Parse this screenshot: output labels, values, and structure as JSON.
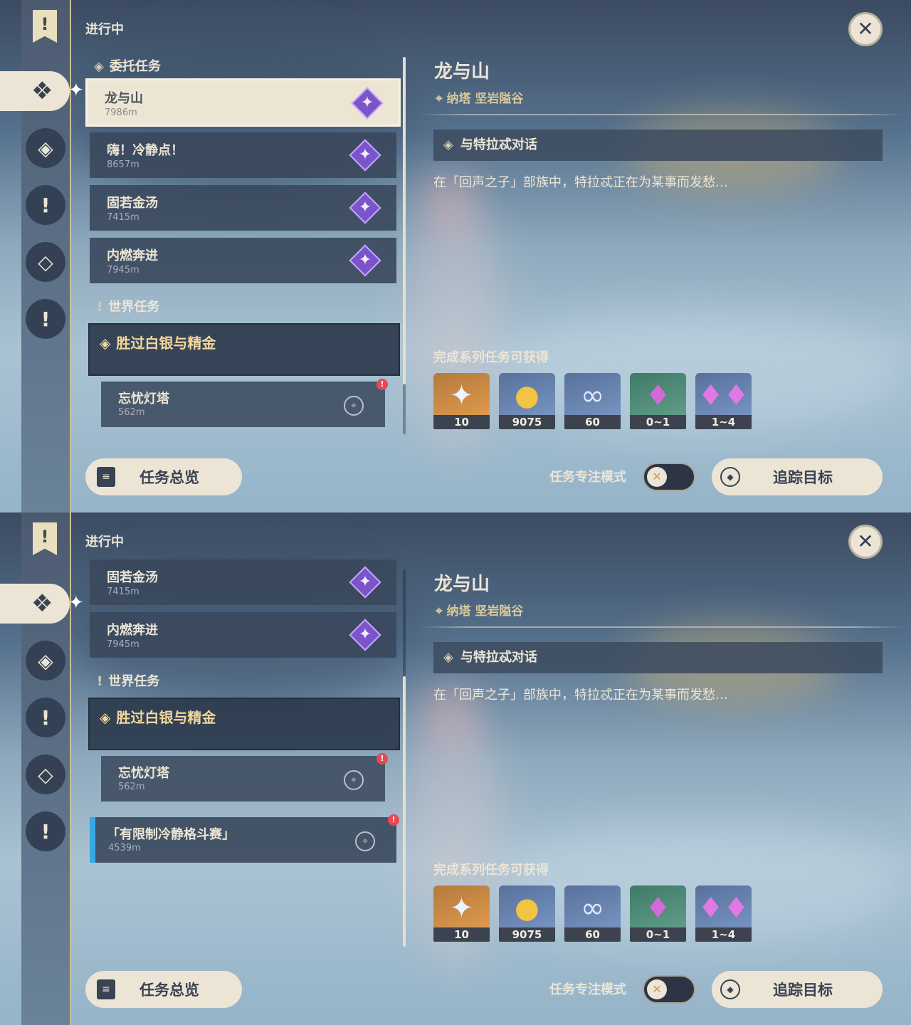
{
  "colors": {
    "panel_bg": "#55708c",
    "card_bg": "#3a485c",
    "selected_card_bg": "#ede5d3",
    "world_title": "#f2d79b",
    "tracked_accent": "#36a9e3",
    "cream": "#ece5d6",
    "alert_red": "#e44a55"
  },
  "sidebar_icons": [
    "quest-banner-icon",
    "commission-icon",
    "archon-quest-icon",
    "world-quest-icon",
    "story-quest-icon",
    "exclamation-icon"
  ],
  "panels": [
    {
      "section_title": "进行中",
      "commission_header": "委托任务",
      "commissions": [
        {
          "title": "龙与山",
          "distance": "7986m"
        },
        {
          "title": "嗨！冷静点！",
          "distance": "8657m"
        },
        {
          "title": "固若金汤",
          "distance": "7415m"
        },
        {
          "title": "内燃奔进",
          "distance": "7945m"
        }
      ],
      "world_header": "世界任务",
      "world_group_title": "胜过白银与精金",
      "world_items": [
        {
          "title": "忘忧灯塔",
          "distance": "562m",
          "alert": "!"
        }
      ],
      "detail": {
        "title": "龙与山",
        "location": "纳塔 坚岩隘谷",
        "objective": "与特拉忒对话",
        "description": "在「回声之子」部族中，特拉忒正在为某事而发愁…",
        "reward_header": "完成系列任务可获得",
        "rewards": [
          {
            "icon": "primogem-icon",
            "qty": "10"
          },
          {
            "icon": "mora-icon",
            "qty": "9075"
          },
          {
            "icon": "companionship-exp-icon",
            "qty": "60"
          },
          {
            "icon": "crystal-icon",
            "qty": "0~1"
          },
          {
            "icon": "crystal-cluster-icon",
            "qty": "1~4"
          }
        ]
      },
      "buttons": {
        "overview": "任务总览",
        "focus_mode": "任务专注模式",
        "track": "追踪目标"
      }
    },
    {
      "section_title": "进行中",
      "commissions": [
        {
          "title": "固若金汤",
          "distance": "7415m"
        },
        {
          "title": "内燃奔进",
          "distance": "7945m"
        }
      ],
      "world_header": "世界任务",
      "world_group_title": "胜过白银与精金",
      "world_items": [
        {
          "title": "忘忧灯塔",
          "distance": "562m",
          "alert": "!"
        }
      ],
      "tracked_item": {
        "title": "「有限制冷静格斗赛」",
        "distance": "4539m",
        "alert": "!"
      },
      "detail": {
        "title": "龙与山",
        "location": "纳塔 坚岩隘谷",
        "objective": "与特拉忒对话",
        "description": "在「回声之子」部族中，特拉忒正在为某事而发愁…",
        "reward_header": "完成系列任务可获得",
        "rewards": [
          {
            "icon": "primogem-icon",
            "qty": "10"
          },
          {
            "icon": "mora-icon",
            "qty": "9075"
          },
          {
            "icon": "companionship-exp-icon",
            "qty": "60"
          },
          {
            "icon": "crystal-icon",
            "qty": "0~1"
          },
          {
            "icon": "crystal-cluster-icon",
            "qty": "1~4"
          }
        ]
      },
      "buttons": {
        "overview": "任务总览",
        "focus_mode": "任务专注模式",
        "track": "追踪目标"
      }
    }
  ]
}
